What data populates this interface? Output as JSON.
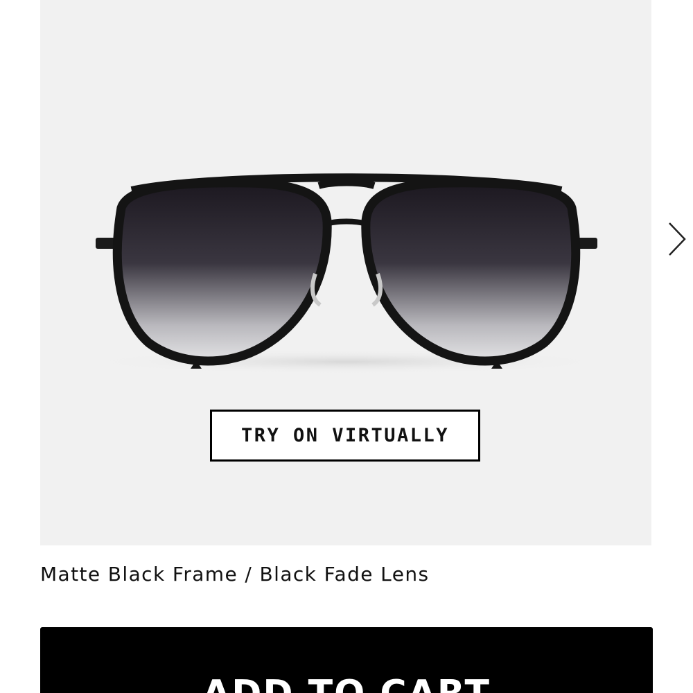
{
  "product": {
    "try_on_label": "TRY ON VIRTUALLY",
    "variant_label": "Matte Black Frame / Black Fade Lens",
    "add_to_cart_label": "ADD TO CART"
  },
  "icons": {
    "next": "chevron-right-icon"
  },
  "colors": {
    "image_background": "#f1f1f1",
    "frame": "#1a1a1a",
    "button_background": "#000000",
    "button_text": "#ffffff"
  }
}
